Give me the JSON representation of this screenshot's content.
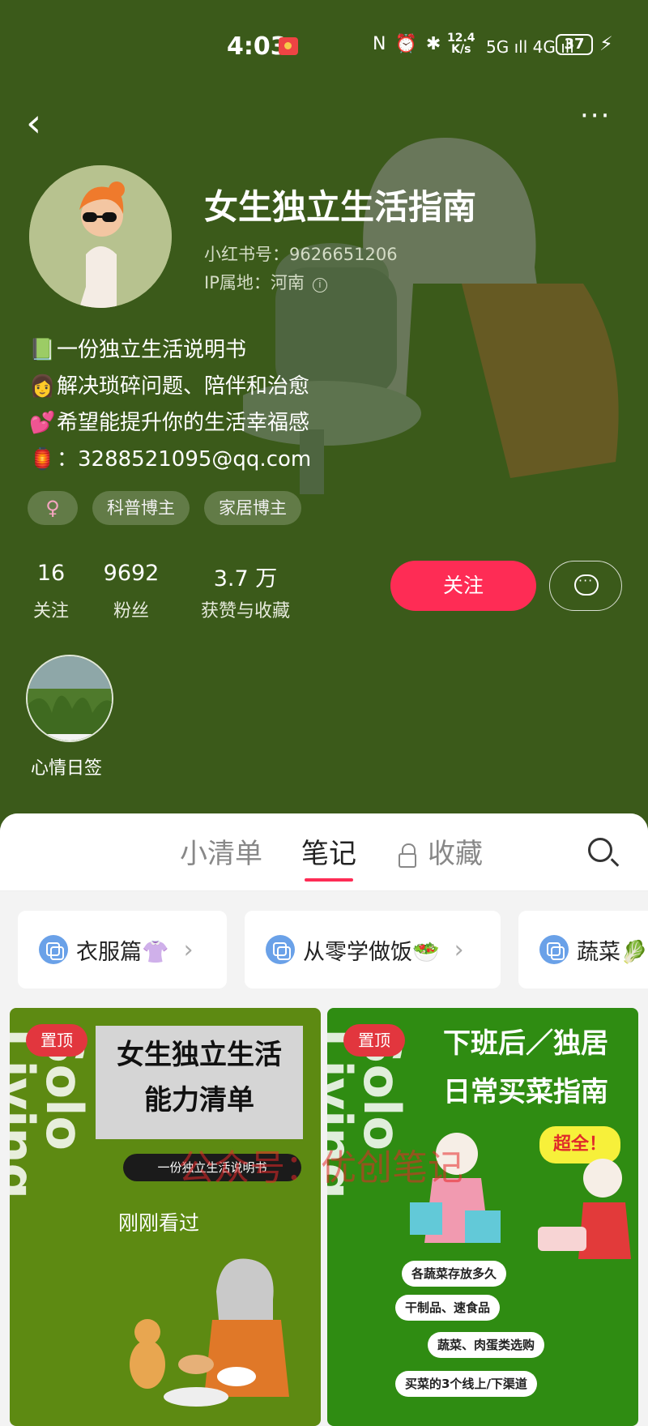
{
  "status_bar": {
    "time": "4:03",
    "system_icons": "N ⏰ ✱",
    "net_speed_top": "12.4",
    "net_speed_bottom": "K/s",
    "signal": "5G ıll 4G ıll",
    "battery": "37",
    "charging": "⚡"
  },
  "nav": {
    "back": "‹",
    "more": "···"
  },
  "profile": {
    "name": "女生独立生活指南",
    "id_line": "小红书号：9626651206",
    "ip_line": "IP属地：河南",
    "info_icon": "i"
  },
  "bio": [
    {
      "emoji": "📗",
      "text": "一份独立生活说明书"
    },
    {
      "emoji": "👩",
      "text": "解决琐碎问题、陪伴和治愈"
    },
    {
      "emoji": "💕",
      "text": "希望能提升你的生活幸福感"
    },
    {
      "emoji": "🏮",
      "text": "：3288521095@qq.com"
    }
  ],
  "tags": {
    "gender": "♀",
    "t1": "科普博主",
    "t2": "家居博主"
  },
  "stats": [
    {
      "num": "16",
      "label": "关注"
    },
    {
      "num": "9692",
      "label": "粉丝"
    },
    {
      "num": "3.7 万",
      "label": "获赞与收藏"
    }
  ],
  "actions": {
    "follow": "关注"
  },
  "highlight": {
    "label": "心情日签"
  },
  "tabs": {
    "t1": "小清单",
    "t2": "笔记",
    "t3": "收藏"
  },
  "collections": [
    {
      "label": "衣服篇👚"
    },
    {
      "label": "从零学做饭🥗"
    },
    {
      "label": "蔬菜🥬"
    }
  ],
  "notes": {
    "pin": "置顶",
    "vertical": "Solo Living",
    "left": {
      "title_line1": "女生独立生活",
      "title_line2": "能力清单",
      "sub": "一份独立生活说明书",
      "viewed": "刚刚看过"
    },
    "right": {
      "title_line1": "下班后／独居",
      "title_line2": "日常买菜指南",
      "badge": "超全！",
      "items": [
        "各蔬菜存放多久",
        "干制品、速食品",
        "蔬菜、肉蛋类选购",
        "买菜的3个线上/下渠道"
      ]
    }
  },
  "watermark": "公众号：优创笔记",
  "colors": {
    "header_bg": "#3b5a1a",
    "accent": "#fe2c55"
  }
}
